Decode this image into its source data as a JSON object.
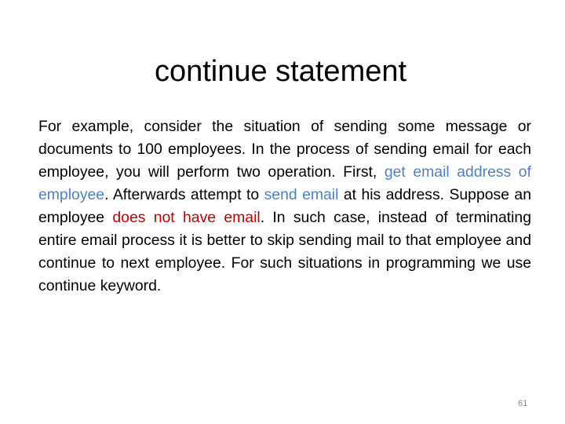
{
  "slide": {
    "title": "continue statement",
    "paragraph": [
      {
        "text": "For example, consider the situation of sending some message or documents to 100 employees. In the process of sending email for each employee, you will perform two operation. First, ",
        "style": "normal"
      },
      {
        "text": "get email address of employee",
        "style": "blue"
      },
      {
        "text": ". Afterwards attempt to ",
        "style": "normal"
      },
      {
        "text": "send email",
        "style": "blue"
      },
      {
        "text": " at his address. Suppose an employee ",
        "style": "normal"
      },
      {
        "text": "does not have email",
        "style": "red"
      },
      {
        "text": ". In such case, instead of terminating entire email process it is better to skip sending mail to that employee and continue to next employee. For such situations in programming we use continue keyword.",
        "style": "normal"
      }
    ],
    "page_number": "61",
    "colors": {
      "highlight_blue": "#4f81bd",
      "highlight_red": "#c00000"
    }
  }
}
